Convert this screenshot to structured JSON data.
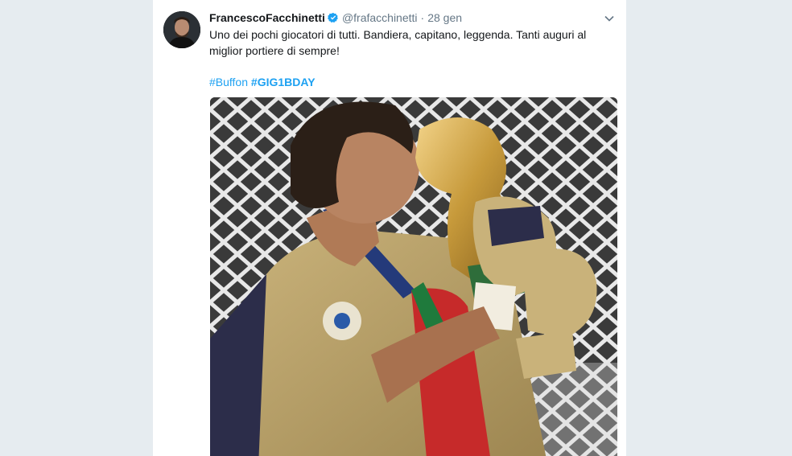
{
  "tweet": {
    "author_name": "FrancescoFacchinetti",
    "author_handle": "@frafacchinetti",
    "separator": "·",
    "timestamp": "28 gen",
    "text": "Uno dei pochi giocatori di tutti. Bandiera, capitano, leggenda. Tanti auguri al miglior portiere di sempre!",
    "hashtags": [
      "#Buffon",
      "#GIG1BDAY"
    ],
    "media_description": "goalkeeper kissing world cup trophy"
  },
  "colors": {
    "background": "#e6ecf0",
    "link": "#1da1f2",
    "verified": "#1da1f2",
    "muted": "#657786",
    "text": "#14171a"
  },
  "icons": {
    "verified": "verified-badge-icon",
    "menu": "chevron-down-icon"
  }
}
